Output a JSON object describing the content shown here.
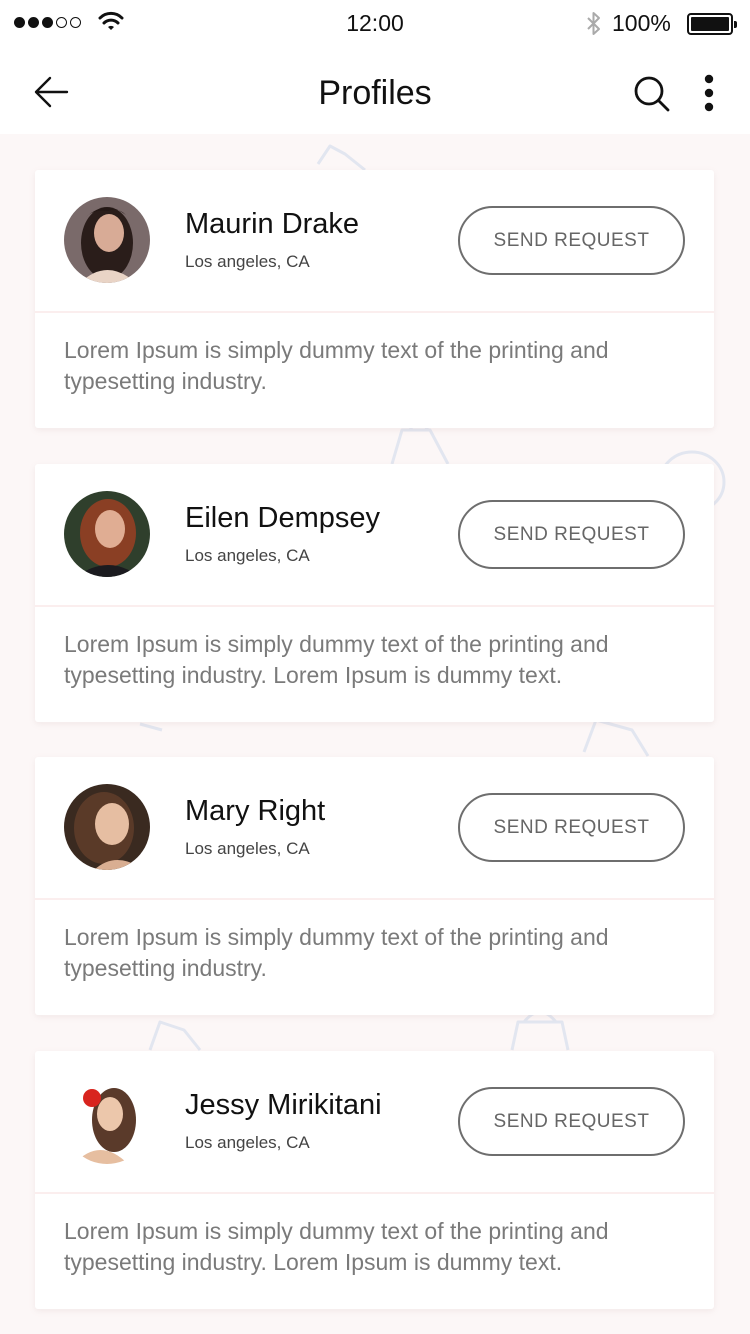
{
  "status_bar": {
    "time": "12:00",
    "battery": "100%",
    "signal_bars_filled": 3,
    "signal_bars_total": 5,
    "icons": [
      "signal-dots-icon",
      "wifi-icon",
      "bluetooth-icon",
      "battery-icon"
    ]
  },
  "app_bar": {
    "title": "Profiles",
    "icons": [
      "back-arrow-icon",
      "search-icon",
      "more-vertical-icon"
    ]
  },
  "profiles": [
    {
      "name": "Maurin Drake",
      "location": "Los angeles, CA",
      "button": "SEND REQUEST",
      "description": "Lorem Ipsum is simply dummy text of the printing and typesetting industry.",
      "avatar_colors": [
        "#3b2a26",
        "#c99b86"
      ]
    },
    {
      "name": "Eilen Dempsey",
      "location": "Los angeles, CA",
      "button": "SEND REQUEST",
      "description": "Lorem Ipsum is simply dummy text of the printing and typesetting industry. Lorem Ipsum is dummy text.",
      "avatar_colors": [
        "#6b3522",
        "#d8a487"
      ]
    },
    {
      "name": "Mary Right",
      "location": "Los angeles, CA",
      "button": "SEND REQUEST",
      "description": "Lorem Ipsum is simply dummy text of the printing and typesetting industry.",
      "avatar_colors": [
        "#4a3326",
        "#e0b89c"
      ]
    },
    {
      "name": "Jessy Mirikitani",
      "location": "Los angeles, CA",
      "button": "SEND REQUEST",
      "description": "Lorem Ipsum is simply dummy text of the printing and typesetting industry. Lorem Ipsum is dummy text.",
      "avatar_colors": [
        "#5a3a2a",
        "#e6c0a4"
      ]
    }
  ],
  "colors": {
    "background": "#fcf7f7",
    "card": "#ffffff",
    "button_border": "#6e6e6e",
    "text_primary": "#111111",
    "text_secondary": "#7a7a7a"
  }
}
